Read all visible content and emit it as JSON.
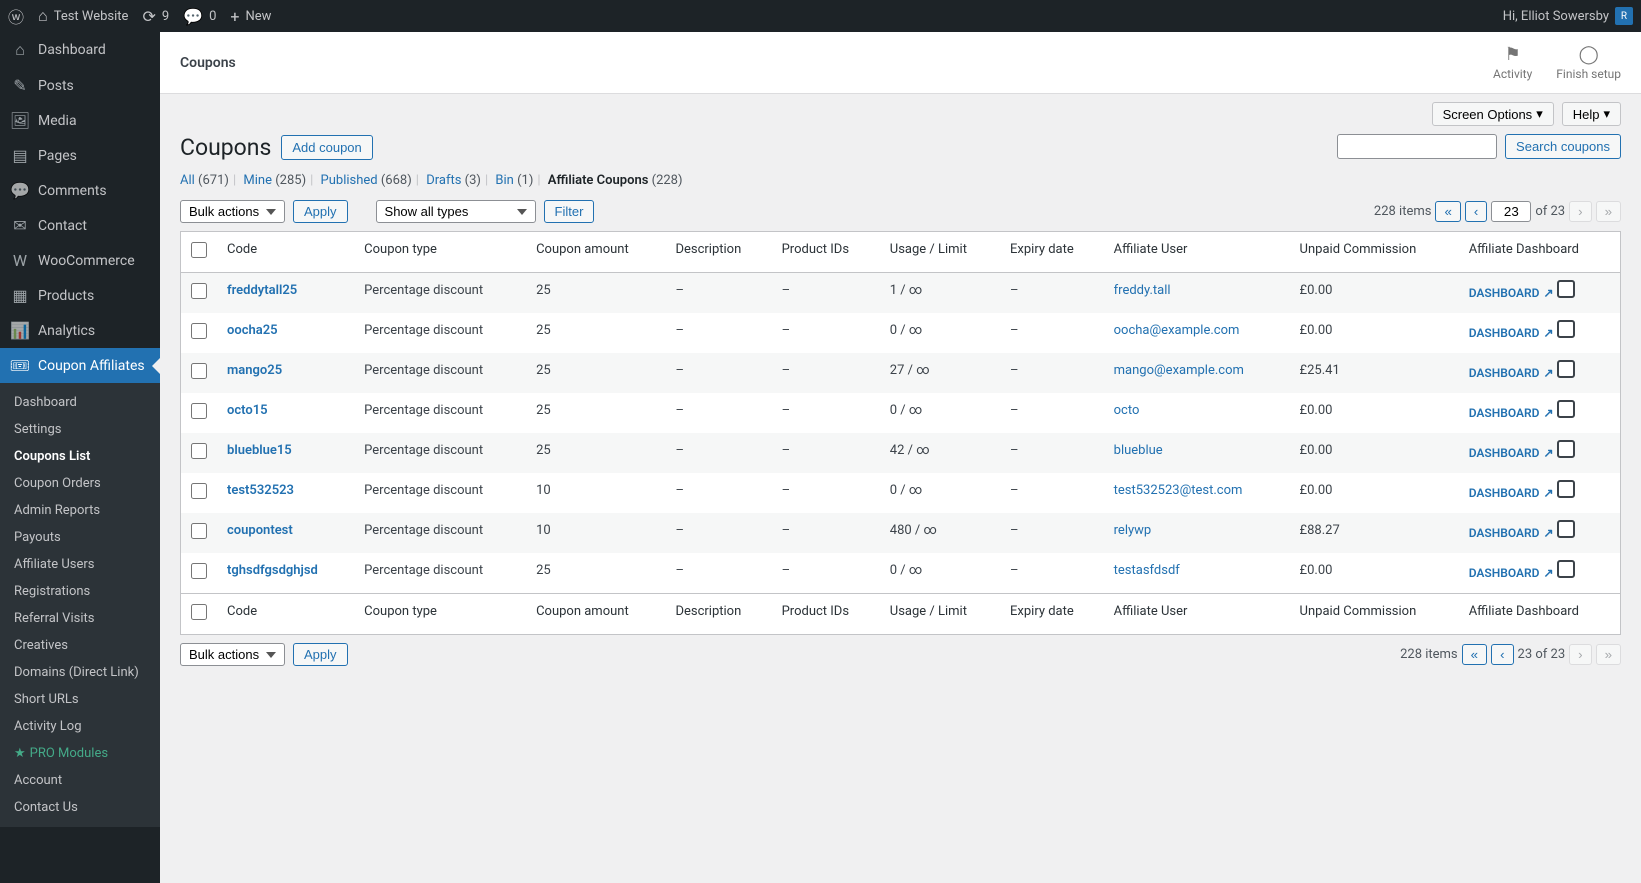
{
  "adminbar": {
    "site": "Test Website",
    "updates": "9",
    "comments": "0",
    "new": "New",
    "greeting": "Hi, Elliot Sowersby",
    "avatar_initial": "R"
  },
  "sidebar": {
    "items": [
      {
        "label": "Dashboard",
        "icon": "⌂"
      },
      {
        "label": "Posts",
        "icon": "✎"
      },
      {
        "label": "Media",
        "icon": "🖼"
      },
      {
        "label": "Pages",
        "icon": "▤"
      },
      {
        "label": "Comments",
        "icon": "💬"
      },
      {
        "label": "Contact",
        "icon": "✉"
      },
      {
        "label": "WooCommerce",
        "icon": "W"
      },
      {
        "label": "Products",
        "icon": "▦"
      },
      {
        "label": "Analytics",
        "icon": "📊"
      },
      {
        "label": "Coupon Affiliates",
        "icon": "🎟",
        "current": true
      }
    ],
    "submenu": [
      {
        "label": "Dashboard"
      },
      {
        "label": "Settings"
      },
      {
        "label": "Coupons List",
        "current": true
      },
      {
        "label": "Coupon Orders"
      },
      {
        "label": "Admin Reports"
      },
      {
        "label": "Payouts"
      },
      {
        "label": "Affiliate Users"
      },
      {
        "label": "Registrations"
      },
      {
        "label": "Referral Visits"
      },
      {
        "label": "Creatives"
      },
      {
        "label": "Domains (Direct Link)"
      },
      {
        "label": "Short URLs"
      },
      {
        "label": "Activity Log"
      },
      {
        "label": "PRO Modules",
        "pro": true
      },
      {
        "label": "Account"
      },
      {
        "label": "Contact Us"
      }
    ]
  },
  "header": {
    "title": "Coupons",
    "activity": "Activity",
    "finish": "Finish setup"
  },
  "subheader": {
    "screen_options": "Screen Options",
    "help": "Help"
  },
  "page": {
    "title": "Coupons",
    "add_button": "Add coupon"
  },
  "filters": {
    "all_label": "All",
    "all_count": "(671)",
    "mine_label": "Mine",
    "mine_count": "(285)",
    "published_label": "Published",
    "published_count": "(668)",
    "drafts_label": "Drafts",
    "drafts_count": "(3)",
    "bin_label": "Bin",
    "bin_count": "(1)",
    "affiliate_label": "Affiliate Coupons",
    "affiliate_count": "(228)"
  },
  "controls": {
    "bulk": "Bulk actions",
    "apply": "Apply",
    "type_filter": "Show all types",
    "filter": "Filter",
    "search": "Search coupons",
    "items_count": "228 items",
    "page_current": "23",
    "page_total": "of 23",
    "page_total_bottom": "23 of 23"
  },
  "columns": {
    "code": "Code",
    "type": "Coupon type",
    "amount": "Coupon amount",
    "description": "Description",
    "products": "Product IDs",
    "usage": "Usage / Limit",
    "expiry": "Expiry date",
    "affiliate": "Affiliate User",
    "commission": "Unpaid Commission",
    "dashboard": "Affiliate Dashboard"
  },
  "rows": [
    {
      "code": "freddytall25",
      "type": "Percentage discount",
      "amount": "25",
      "description": "–",
      "products": "–",
      "usage": "1 / ∞",
      "expiry": "–",
      "affiliate": "freddy.tall",
      "commission": "£0.00",
      "dashlink": "DASHBOARD"
    },
    {
      "code": "oocha25",
      "type": "Percentage discount",
      "amount": "25",
      "description": "–",
      "products": "–",
      "usage": "0 / ∞",
      "expiry": "–",
      "affiliate": "oocha@example.com",
      "commission": "£0.00",
      "dashlink": "DASHBOARD"
    },
    {
      "code": "mango25",
      "type": "Percentage discount",
      "amount": "25",
      "description": "–",
      "products": "–",
      "usage": "27 / ∞",
      "expiry": "–",
      "affiliate": "mango@example.com",
      "commission": "£25.41",
      "dashlink": "DASHBOARD"
    },
    {
      "code": "octo15",
      "type": "Percentage discount",
      "amount": "25",
      "description": "–",
      "products": "–",
      "usage": "0 / ∞",
      "expiry": "–",
      "affiliate": "octo",
      "commission": "£0.00",
      "dashlink": "DASHBOARD"
    },
    {
      "code": "blueblue15",
      "type": "Percentage discount",
      "amount": "25",
      "description": "–",
      "products": "–",
      "usage": "42 / ∞",
      "expiry": "–",
      "affiliate": "blueblue",
      "commission": "£0.00",
      "dashlink": "DASHBOARD"
    },
    {
      "code": "test532523",
      "type": "Percentage discount",
      "amount": "10",
      "description": "–",
      "products": "–",
      "usage": "0 / ∞",
      "expiry": "–",
      "affiliate": "test532523@test.com",
      "commission": "£0.00",
      "dashlink": "DASHBOARD"
    },
    {
      "code": "coupontest",
      "type": "Percentage discount",
      "amount": "10",
      "description": "–",
      "products": "–",
      "usage": "480 / ∞",
      "expiry": "–",
      "affiliate": "relywp",
      "commission": "£88.27",
      "dashlink": "DASHBOARD"
    },
    {
      "code": "tghsdfgsdghjsd",
      "type": "Percentage discount",
      "amount": "25",
      "description": "–",
      "products": "–",
      "usage": "0 / ∞",
      "expiry": "–",
      "affiliate": "testasfdsdf",
      "commission": "£0.00",
      "dashlink": "DASHBOARD"
    }
  ]
}
